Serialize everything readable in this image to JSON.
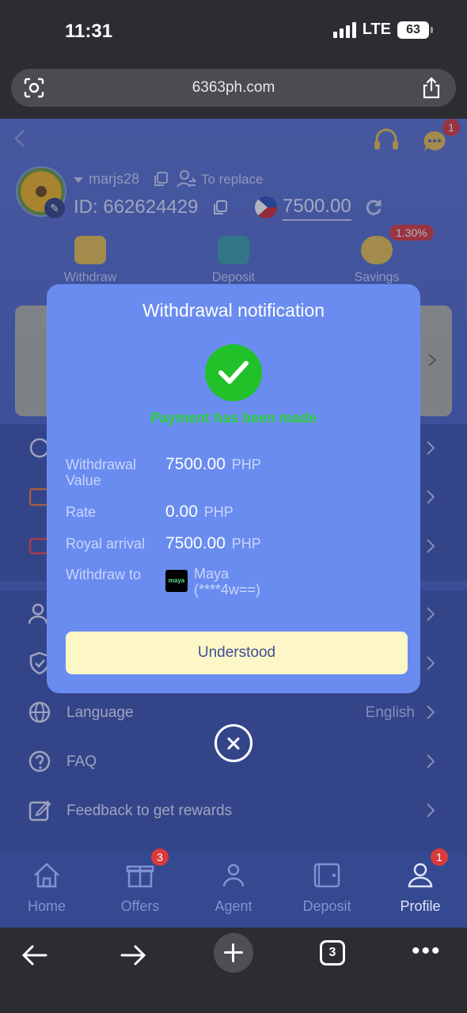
{
  "status_bar": {
    "time": "11:31",
    "network": "LTE",
    "battery": "63"
  },
  "browser": {
    "url": "6363ph.com",
    "tab_count": "3"
  },
  "header": {
    "chat_badge": "1"
  },
  "profile": {
    "username": "marjs28",
    "replace_label": "To replace",
    "id_label": "ID:",
    "id_value": "662624429",
    "balance": "7500.00"
  },
  "quick_actions": {
    "withdraw": "Withdraw",
    "deposit": "Deposit",
    "savings": "Savings",
    "savings_rate": "1.30%"
  },
  "menu": {
    "language_label": "Language",
    "language_value": "English",
    "faq_label": "FAQ",
    "feedback_label": "Feedback to get rewards"
  },
  "modal": {
    "title": "Withdrawal notification",
    "status": "Payment has been made",
    "withdrawal_value_label": "Withdrawal Value",
    "withdrawal_value": "7500.00",
    "rate_label": "Rate",
    "rate_value": "0.00",
    "royal_arrival_label": "Royal arrival",
    "royal_arrival_value": "7500.00",
    "currency": "PHP",
    "withdraw_to_label": "Withdraw to",
    "wallet_logo_text": "maya",
    "wallet_name": "Maya",
    "wallet_account": "(****4w==)",
    "button_label": "Understood"
  },
  "tabbar": {
    "home": "Home",
    "offers": "Offers",
    "offers_badge": "3",
    "agent": "Agent",
    "deposit": "Deposit",
    "profile": "Profile",
    "profile_badge": "1"
  },
  "colors": {
    "modal_bg": "#6a8cf0",
    "success_green": "#21c12a",
    "button_bg": "#fdf6c6",
    "badge_red": "#d93b3b"
  }
}
